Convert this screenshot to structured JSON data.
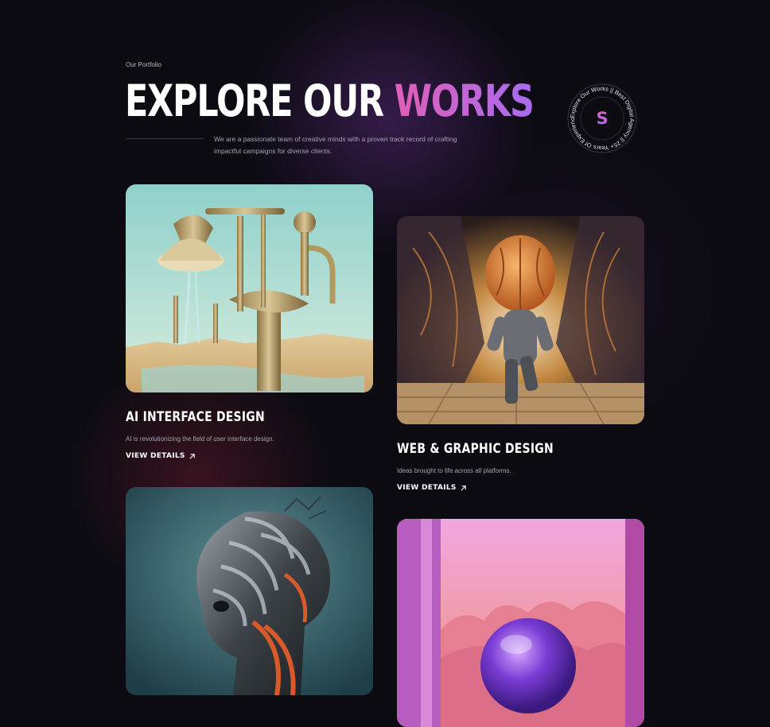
{
  "section": {
    "eyebrow": "Our Portfolio",
    "title_main": "EXPLORE OUR ",
    "title_accent": "WORKS",
    "description": "We are a passionate team of creative minds with a proven track record of crafting impactful campaigns for diverse clients."
  },
  "badge": {
    "letter": "S",
    "ring_text": "Explore Our Works || Best Digital Agency || 25+ Years Of Experience ||"
  },
  "works": [
    {
      "title": "AI INTERFACE DESIGN",
      "description": "AI is revolutionizing the field of user interface design.",
      "link_label": "VIEW DETAILS",
      "image_icon": "surreal-tap-machine-image"
    },
    {
      "title": "WEB & GRAPHIC DESIGN",
      "description": "Ideas brought to life across all platforms.",
      "link_label": "VIEW DETAILS",
      "image_icon": "brain-head-runner-image"
    },
    {
      "title": "",
      "description": "",
      "link_label": "",
      "image_icon": "mechanical-head-image"
    },
    {
      "title": "",
      "description": "",
      "link_label": "",
      "image_icon": "purple-orb-image"
    }
  ],
  "colors": {
    "background": "#0c0b12",
    "accent_start": "#e05fb6",
    "accent_end": "#a86cf0",
    "muted_text": "#a7a2b3"
  }
}
